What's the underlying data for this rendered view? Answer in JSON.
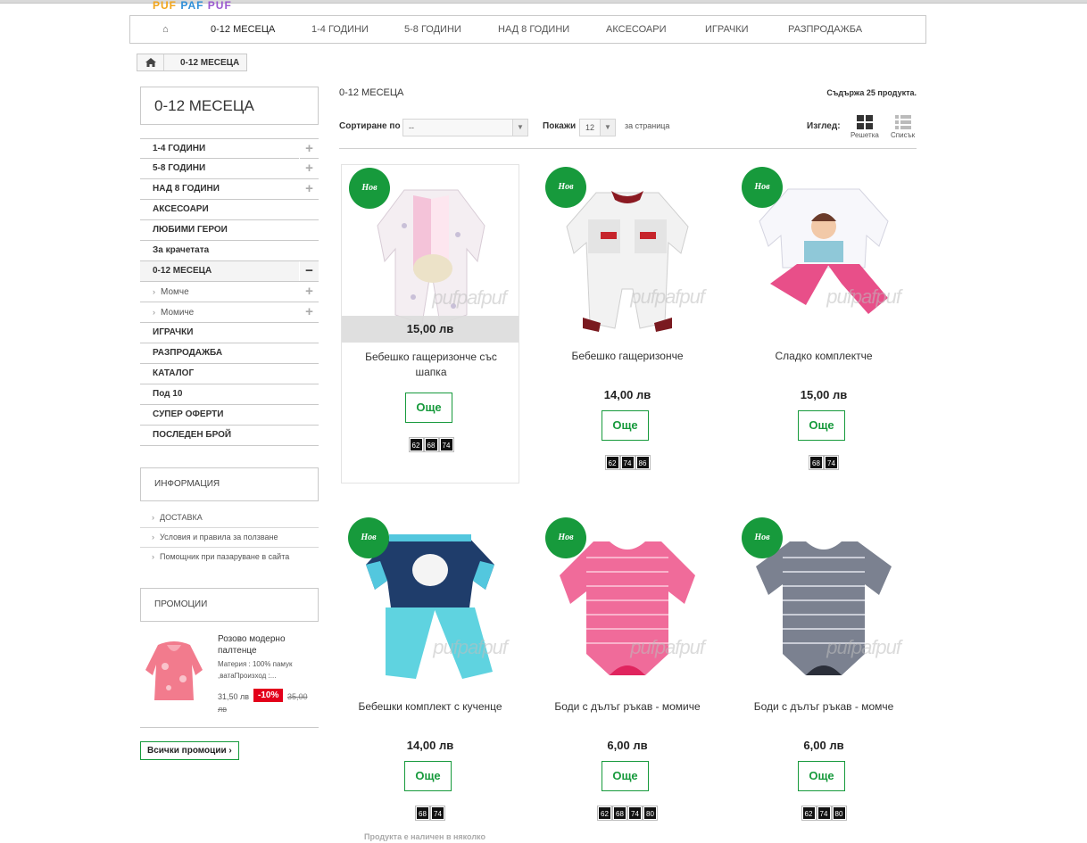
{
  "logo": {
    "parts": [
      "PUF",
      "PAF",
      "PUF"
    ],
    "colors": [
      "#f2a51a",
      "#2f8fd8",
      "#9b59d0"
    ]
  },
  "nav": {
    "home_icon": "home-icon",
    "items": [
      "0-12 МЕСЕЦА",
      "1-4 ГОДИНИ",
      "5-8 ГОДИНИ",
      "НАД 8 ГОДИНИ",
      "АКСЕСОАРИ",
      "ИГРАЧКИ",
      "РАЗПРОДАЖБА"
    ]
  },
  "breadcrumb": {
    "home_icon": "home-icon",
    "current": "0-12 МЕСЕЦА"
  },
  "sidebar": {
    "category_title": "0-12 МЕСЕЦА",
    "categories": [
      {
        "label": "1-4 ГОДИНИ",
        "toggle": "+"
      },
      {
        "label": "5-8 ГОДИНИ",
        "toggle": "+"
      },
      {
        "label": "НАД 8 ГОДИНИ",
        "toggle": "+"
      },
      {
        "label": "АКСЕСОАРИ",
        "toggle": ""
      },
      {
        "label": "ЛЮБИМИ ГЕРОИ",
        "toggle": ""
      },
      {
        "label": "За крачетата",
        "toggle": ""
      },
      {
        "label": "0-12 МЕСЕЦА",
        "toggle": "−"
      },
      {
        "label": "Момче",
        "toggle": "+"
      },
      {
        "label": "Момиче",
        "toggle": "+"
      },
      {
        "label": "ИГРАЧКИ",
        "toggle": ""
      },
      {
        "label": "РАЗПРОДАЖБА",
        "toggle": ""
      },
      {
        "label": "КАТАЛОГ",
        "toggle": ""
      },
      {
        "label": "Под 10",
        "toggle": ""
      },
      {
        "label": "СУПЕР ОФЕРТИ",
        "toggle": ""
      },
      {
        "label": "ПОСЛЕДЕН БРОЙ",
        "toggle": ""
      }
    ],
    "info_title": "ИНФОРМАЦИЯ",
    "info_links": [
      "ДОСТАВКА",
      "Условия и правила за ползване",
      "Помощник при пазаруване в сайта"
    ],
    "promo_title": "ПРОМОЦИИ",
    "promo": {
      "name": "Розово модерно палтенце",
      "desc": "Материя : 100% памук ,ватаПроизход :...",
      "price": "31,50 лв",
      "discount": "-10%",
      "old_price_a": "35,00",
      "old_price_b": "лв"
    },
    "all_promos": "Всички промоции"
  },
  "content": {
    "title": "0-12 МЕСЕЦА",
    "count": "Съдържа 25 продукта.",
    "sort_label": "Сортиране по",
    "sort_value": "--",
    "show_label": "Покажи",
    "show_value": "12",
    "per_page": "за страница",
    "view_label": "Изглед:",
    "view_grid": "Решетка",
    "view_list": "Списък"
  },
  "products": [
    {
      "badge": "Нов",
      "name": "Бебешко гащеризонче със шапка",
      "price": "15,00 лв",
      "button": "Още",
      "sizes": [
        "62",
        "68",
        "74"
      ]
    },
    {
      "badge": "Нов",
      "name": "Бебешко гащеризонче",
      "price": "14,00 лв",
      "button": "Още",
      "sizes": [
        "62",
        "74",
        "86"
      ]
    },
    {
      "badge": "Нов",
      "name": "Сладко комплектче",
      "price": "15,00 лв",
      "button": "Още",
      "sizes": [
        "68",
        "74"
      ]
    },
    {
      "badge": "Нов",
      "name": "Бебешки комплект с кученце",
      "price": "14,00 лв",
      "button": "Още",
      "sizes": [
        "68",
        "74"
      ]
    },
    {
      "badge": "Нов",
      "name": "Боди с дълъг ръкав - момиче",
      "price": "6,00 лв",
      "button": "Още",
      "sizes": [
        "62",
        "68",
        "74",
        "80"
      ]
    },
    {
      "badge": "Нов",
      "name": "Боди с дълъг ръкав - момче",
      "price": "6,00 лв",
      "button": "Още",
      "sizes": [
        "62",
        "74",
        "80"
      ]
    }
  ],
  "watermark": "pufpafpuf",
  "availability_note": "Продукта е наличен в няколко",
  "colors": {
    "accent_green": "#179a3c",
    "discount_red": "#e3001b"
  }
}
